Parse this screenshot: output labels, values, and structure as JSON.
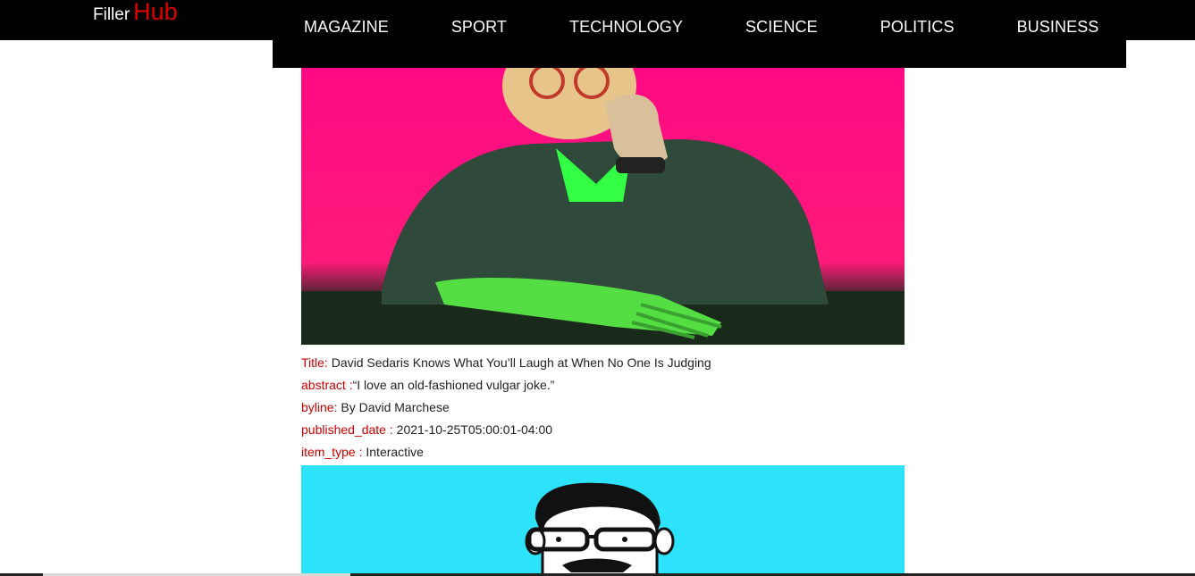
{
  "brand": {
    "first": "Filler",
    "second": "Hub",
    "colors": {
      "bar": "#000000",
      "accent": "#e00000",
      "label": "#cc0000",
      "thumb_bg": "#2de3fb",
      "hero_bg": "#ff0a84"
    }
  },
  "nav": {
    "items": [
      {
        "label": "MAGAZINE"
      },
      {
        "label": "SPORT"
      },
      {
        "label": "TECHNOLOGY"
      },
      {
        "label": "SCIENCE"
      },
      {
        "label": "POLITICS"
      },
      {
        "label": "BUSINESS"
      }
    ]
  },
  "article": {
    "title_label": "Title:",
    "title": "David Sedaris Knows What You’ll Laugh at When No One Is Judging",
    "abstract_label": "abstract :",
    "abstract": "“I love an old-fashioned vulgar joke.”",
    "byline_label": "byline:",
    "byline": "By David Marchese",
    "published_label": "published_date :",
    "published": "2021-10-25T05:00:01-04:00",
    "item_type_label": "item_type :",
    "item_type": "Interactive"
  }
}
